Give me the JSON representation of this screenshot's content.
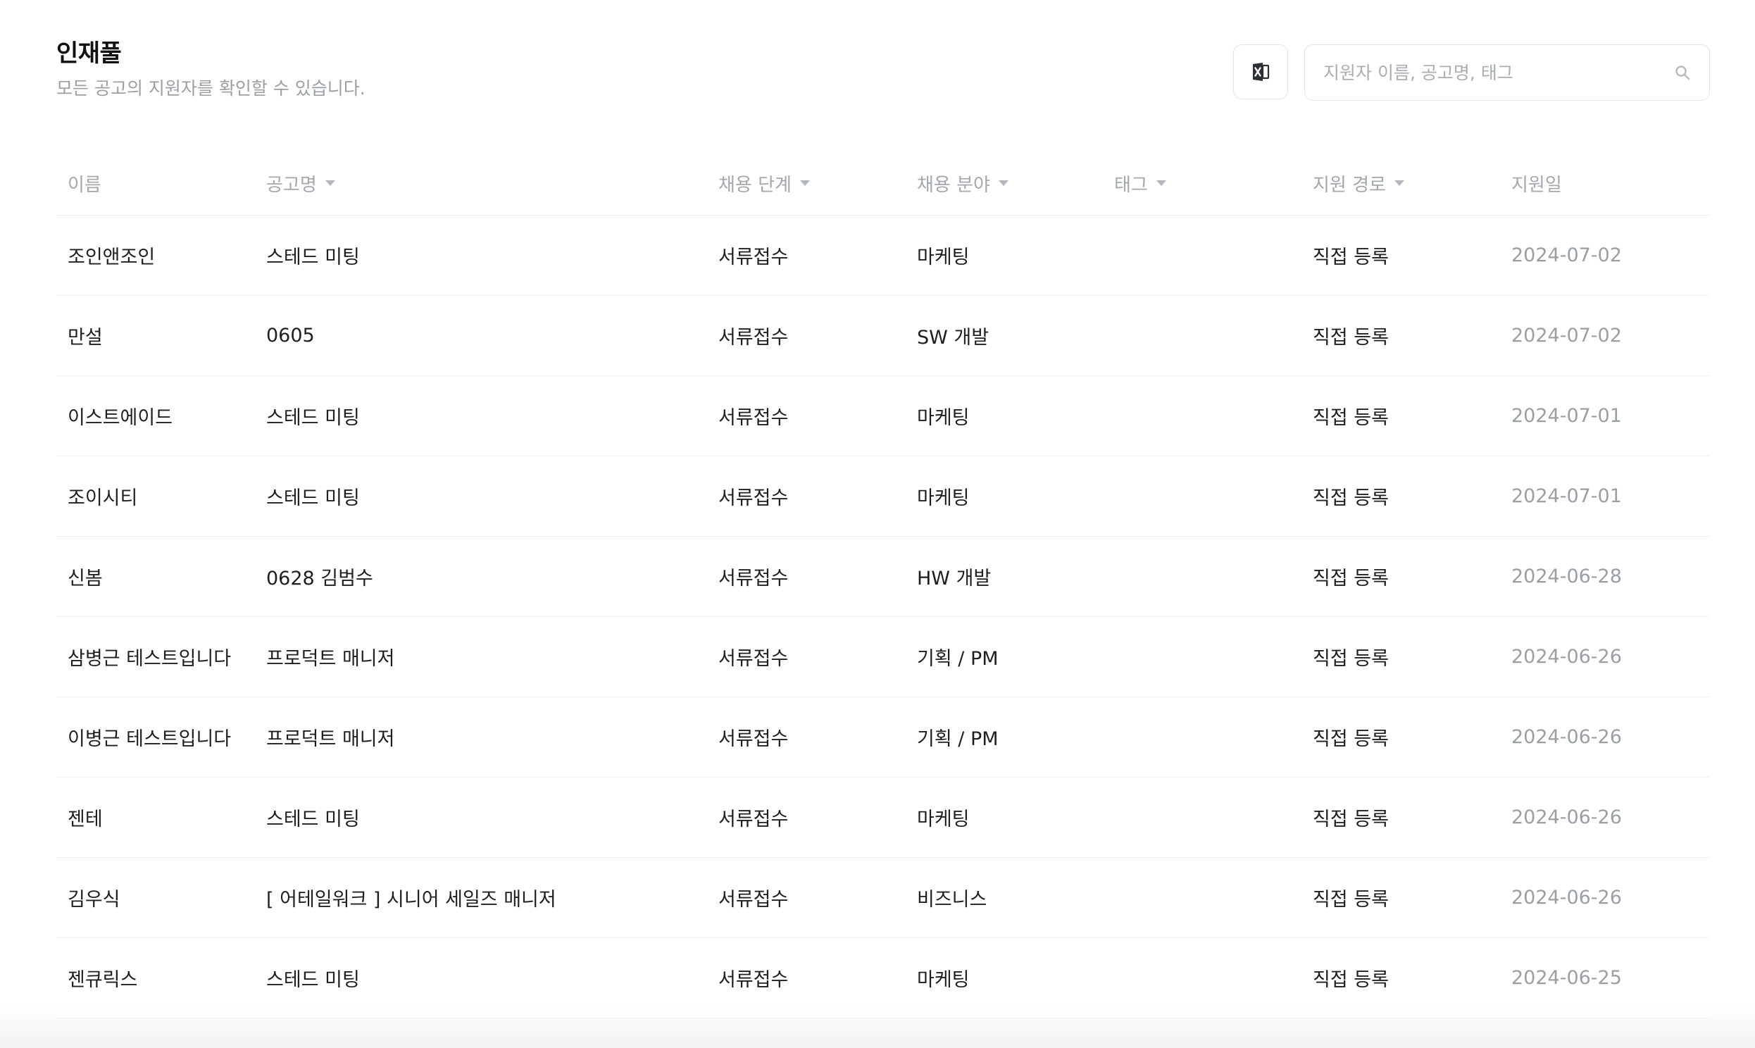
{
  "header": {
    "title": "인재풀",
    "subtitle": "모든 공고의 지원자를 확인할 수 있습니다."
  },
  "toolbar": {
    "excel_icon": "excel-export-icon",
    "search_placeholder": "지원자 이름, 공고명, 태그",
    "search_value": "",
    "search_icon": "search-icon"
  },
  "table": {
    "columns": [
      {
        "label": "이름",
        "sortable": false
      },
      {
        "label": "공고명",
        "sortable": true
      },
      {
        "label": "채용 단계",
        "sortable": true
      },
      {
        "label": "채용 분야",
        "sortable": true
      },
      {
        "label": "태그",
        "sortable": true
      },
      {
        "label": "지원 경로",
        "sortable": true
      },
      {
        "label": "지원일",
        "sortable": false
      }
    ],
    "rows": [
      {
        "name": "조인앤조인",
        "job": "스테드 미팅",
        "stage": "서류접수",
        "field": "마케팅",
        "tag": "",
        "source": "직접 등록",
        "date": "2024-07-02"
      },
      {
        "name": "만설",
        "job": "0605",
        "stage": "서류접수",
        "field": "SW 개발",
        "tag": "",
        "source": "직접 등록",
        "date": "2024-07-02"
      },
      {
        "name": "이스트에이드",
        "job": "스테드 미팅",
        "stage": "서류접수",
        "field": "마케팅",
        "tag": "",
        "source": "직접 등록",
        "date": "2024-07-01"
      },
      {
        "name": "조이시티",
        "job": "스테드 미팅",
        "stage": "서류접수",
        "field": "마케팅",
        "tag": "",
        "source": "직접 등록",
        "date": "2024-07-01"
      },
      {
        "name": "신봄",
        "job": "0628 김범수",
        "stage": "서류접수",
        "field": "HW 개발",
        "tag": "",
        "source": "직접 등록",
        "date": "2024-06-28"
      },
      {
        "name": "삼병근 테스트입니다",
        "job": "프로덕트 매니저",
        "stage": "서류접수",
        "field": "기획 / PM",
        "tag": "",
        "source": "직접 등록",
        "date": "2024-06-26"
      },
      {
        "name": "이병근 테스트입니다",
        "job": "프로덕트 매니저",
        "stage": "서류접수",
        "field": "기획 / PM",
        "tag": "",
        "source": "직접 등록",
        "date": "2024-06-26"
      },
      {
        "name": "젠테",
        "job": "스테드 미팅",
        "stage": "서류접수",
        "field": "마케팅",
        "tag": "",
        "source": "직접 등록",
        "date": "2024-06-26"
      },
      {
        "name": "김우식",
        "job": "[ 어테일워크 ] 시니어 세일즈 매니저",
        "stage": "서류접수",
        "field": "비즈니스",
        "tag": "",
        "source": "직접 등록",
        "date": "2024-06-26"
      },
      {
        "name": "젠큐릭스",
        "job": "스테드 미팅",
        "stage": "서류접수",
        "field": "마케팅",
        "tag": "",
        "source": "직접 등록",
        "date": "2024-06-25"
      }
    ]
  }
}
